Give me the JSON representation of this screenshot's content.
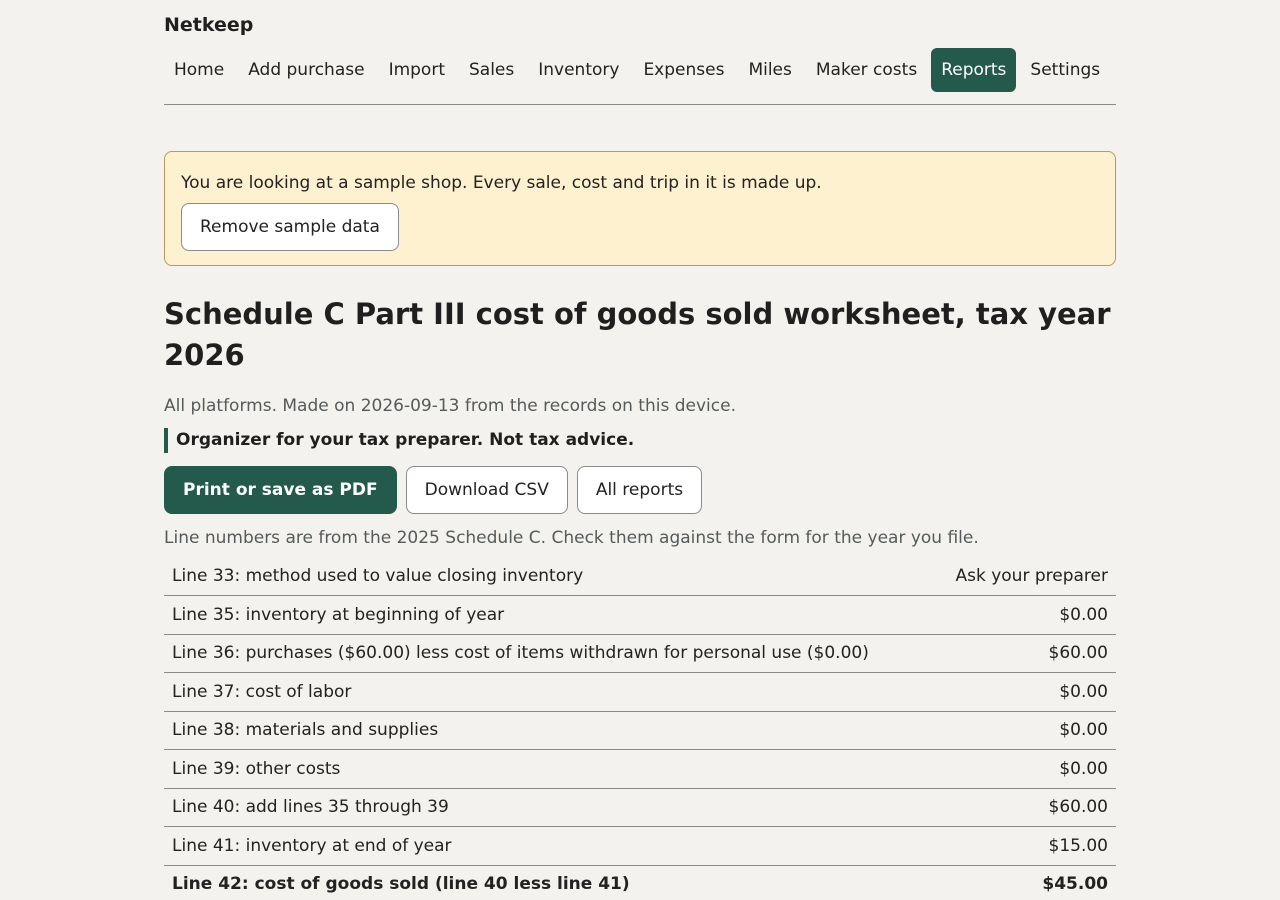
{
  "app": {
    "title": "Netkeep"
  },
  "nav": {
    "items": [
      {
        "label": "Home",
        "active": false
      },
      {
        "label": "Add purchase",
        "active": false
      },
      {
        "label": "Import",
        "active": false
      },
      {
        "label": "Sales",
        "active": false
      },
      {
        "label": "Inventory",
        "active": false
      },
      {
        "label": "Expenses",
        "active": false
      },
      {
        "label": "Miles",
        "active": false
      },
      {
        "label": "Maker costs",
        "active": false
      },
      {
        "label": "Reports",
        "active": true
      },
      {
        "label": "Settings",
        "active": false
      }
    ]
  },
  "banner": {
    "text": "You are looking at a sample shop. Every sale, cost and trip in it is made up.",
    "button_label": "Remove sample data"
  },
  "page": {
    "title": "Schedule C Part III cost of goods sold worksheet, tax year 2026",
    "subtitle": "All platforms. Made on 2026-09-13 from the records on this device.",
    "disclaimer": "Organizer for your tax preparer. Not tax advice.",
    "actions": {
      "print_label": "Print or save as PDF",
      "csv_label": "Download CSV",
      "reports_label": "All reports"
    },
    "note": "Line numbers are from the 2025 Schedule C. Check them against the form for the year you file."
  },
  "worksheet": {
    "rows": [
      {
        "label": "Line 33: method used to value closing inventory",
        "value": "Ask your preparer",
        "total": false
      },
      {
        "label": "Line 35: inventory at beginning of year",
        "value": "$0.00",
        "total": false
      },
      {
        "label": "Line 36: purchases ($60.00) less cost of items withdrawn for personal use ($0.00)",
        "value": "$60.00",
        "total": false
      },
      {
        "label": "Line 37: cost of labor",
        "value": "$0.00",
        "total": false
      },
      {
        "label": "Line 38: materials and supplies",
        "value": "$0.00",
        "total": false
      },
      {
        "label": "Line 39: other costs",
        "value": "$0.00",
        "total": false
      },
      {
        "label": "Line 40: add lines 35 through 39",
        "value": "$60.00",
        "total": false
      },
      {
        "label": "Line 41: inventory at end of year",
        "value": "$15.00",
        "total": false
      },
      {
        "label": "Line 42: cost of goods sold (line 40 less line 41)",
        "value": "$45.00",
        "total": true
      }
    ]
  },
  "colors": {
    "accent": "#245a4b",
    "background": "#f3f2ee",
    "banner_bg": "#fef1cf",
    "banner_border": "#b89a5a"
  }
}
